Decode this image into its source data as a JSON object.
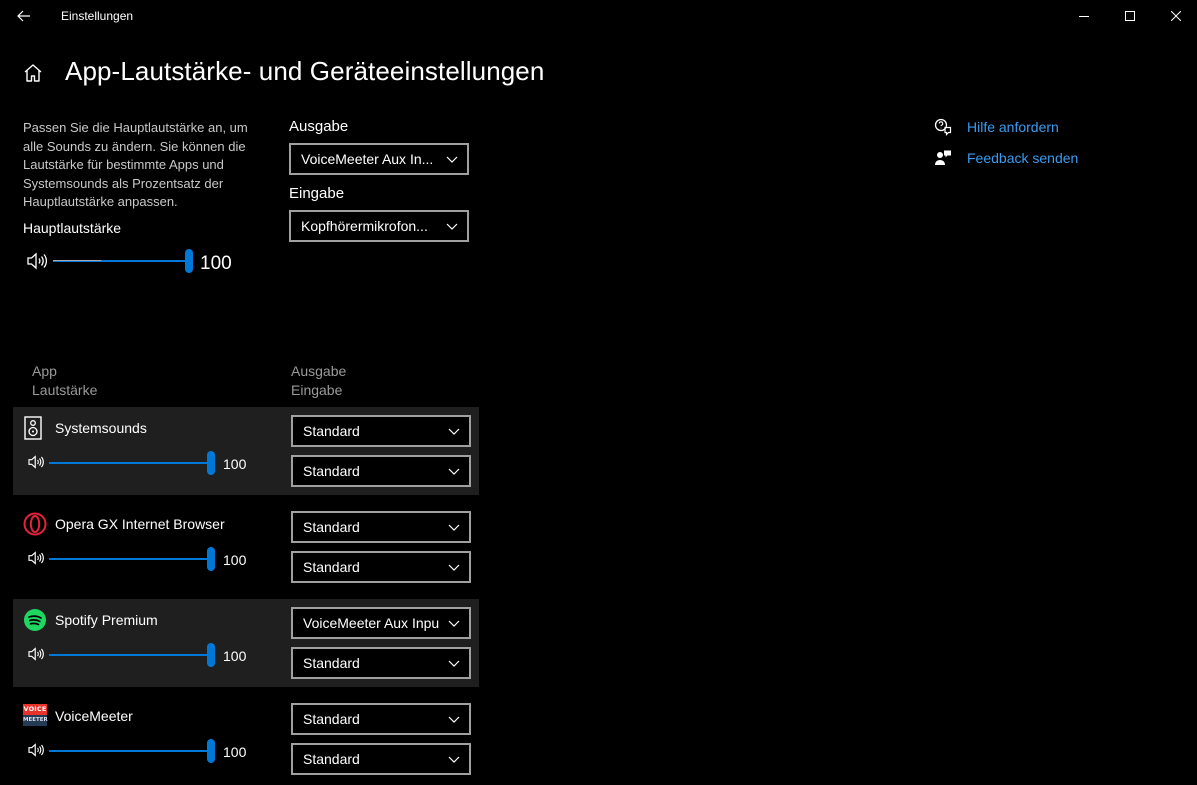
{
  "window": {
    "title": "Einstellungen"
  },
  "page": {
    "title": "App-Lautstärke- und Geräteeinstellungen",
    "description": "Passen Sie die Hauptlautstärke an, um alle Sounds zu ändern. Sie können die Lautstärke für bestimmte Apps und Systemsounds als Prozentsatz der Hauptlautstärke anpassen."
  },
  "master": {
    "label": "Hauptlautstärke",
    "value": "100",
    "level": 1.0
  },
  "output": {
    "label": "Ausgabe",
    "selected": "VoiceMeeter Aux In..."
  },
  "input": {
    "label": "Eingabe",
    "selected": "Kopfhörermikrofon..."
  },
  "links": {
    "help": "Hilfe anfordern",
    "feedback": "Feedback senden"
  },
  "columns": {
    "app": "App",
    "volume": "Lautstärke",
    "output": "Ausgabe",
    "input": "Eingabe"
  },
  "apps": [
    {
      "name": "Systemsounds",
      "icon": "speaker-icon",
      "volume": "100",
      "level": 1.0,
      "output": "Standard",
      "input": "Standard"
    },
    {
      "name": "Opera GX Internet Browser",
      "icon": "opera-gx-icon",
      "volume": "100",
      "level": 1.0,
      "output": "Standard",
      "input": "Standard"
    },
    {
      "name": "Spotify Premium",
      "icon": "spotify-icon",
      "volume": "100",
      "level": 1.0,
      "output": "VoiceMeeter Aux Inpu",
      "input": "Standard"
    },
    {
      "name": "VoiceMeeter",
      "icon": "voicemeeter-icon",
      "volume": "100",
      "level": 1.0,
      "output": "Standard",
      "input": "Standard"
    }
  ],
  "voicemeeter_logo": {
    "top": "VOICE",
    "bottom": "MEETER"
  },
  "colors": {
    "accent": "#0078d7",
    "link": "#3a9bf0",
    "background": "#000000",
    "row_highlight": "#1f1f1f",
    "opera": "#e8213a",
    "spotify": "#1ed760"
  }
}
